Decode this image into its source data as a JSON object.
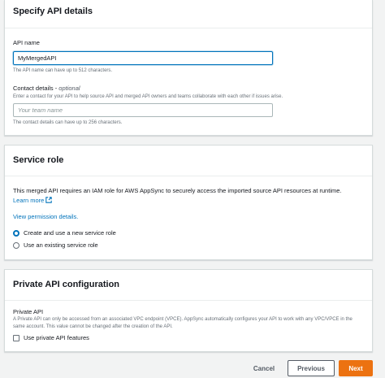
{
  "api_details": {
    "title": "Specify API details",
    "api_name_label": "API name",
    "api_name_value": "MyMergedAPI",
    "api_name_hint": "The API name can have up to 512 characters.",
    "contact_label": "Contact details - ",
    "contact_optional": "optional",
    "contact_desc": "Enter a contact for your API to help source API and merged API owners and teams collaborate with each other if issues arise.",
    "contact_placeholder": "Your team name",
    "contact_hint": "The contact details can have up to 256 characters."
  },
  "service_role": {
    "title": "Service role",
    "desc": "This merged API requires an IAM role for AWS AppSync to securely access the imported source API resources at runtime.",
    "learn_more": "Learn more",
    "view_permission": "View permission details.",
    "options": [
      {
        "label": "Create and use a new service role",
        "checked": true
      },
      {
        "label": "Use an existing service role",
        "checked": false
      }
    ]
  },
  "private_api": {
    "title": "Private API configuration",
    "label": "Private API",
    "desc": "A Private API can only be accessed from an associated VPC endpoint (VPCE). AppSync automatically configures your API to work with any VPC/VPCE in the same account. This value cannot be changed after the creation of the API.",
    "checkbox_label": "Use private API features",
    "checked": false
  },
  "footer": {
    "cancel": "Cancel",
    "previous": "Previous",
    "next": "Next"
  },
  "colors": {
    "accent": "#0073bb",
    "primary_button": "#ec7211"
  }
}
